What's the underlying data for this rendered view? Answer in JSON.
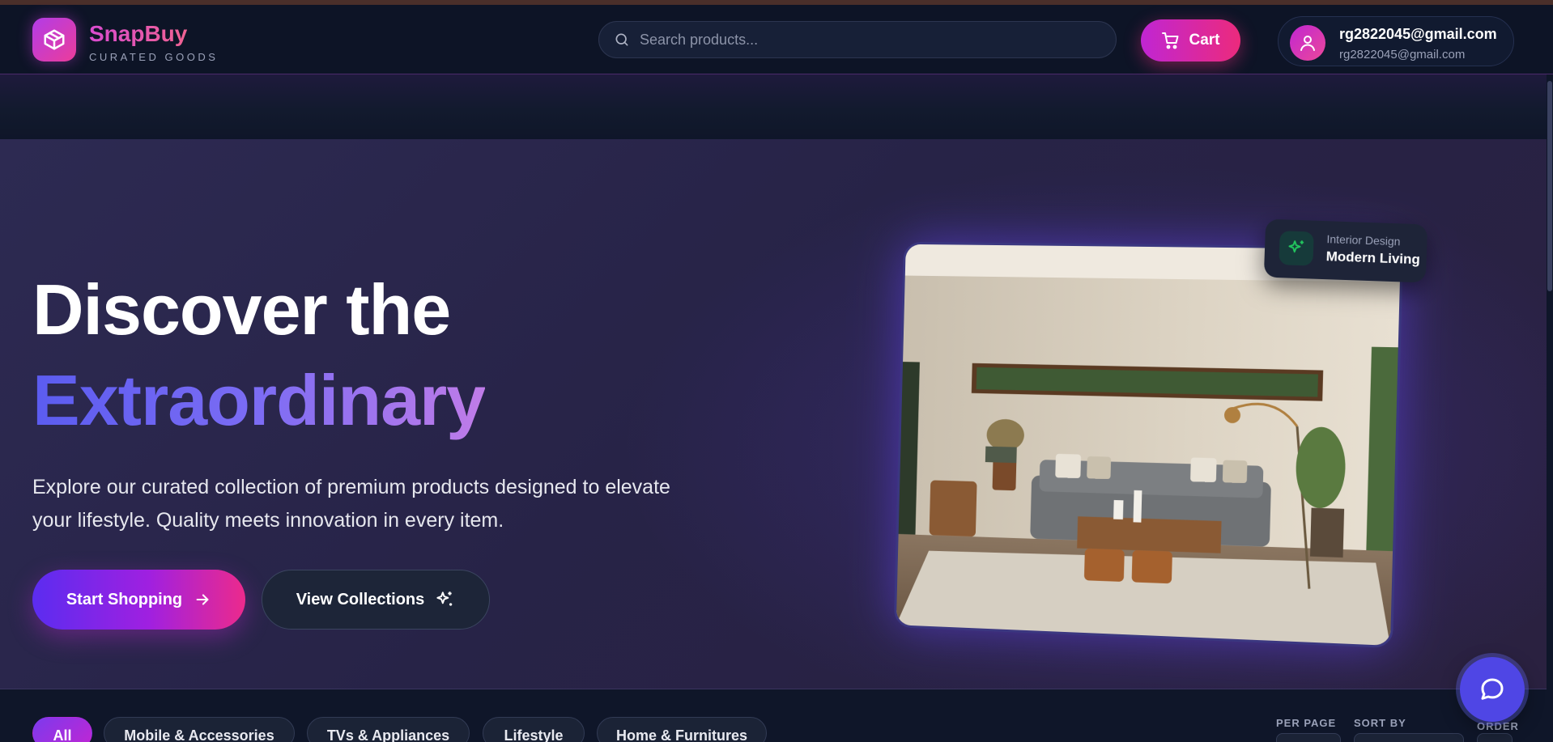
{
  "header": {
    "brand_name": "SnapBuy",
    "brand_tagline": "CURATED GOODS",
    "search_placeholder": "Search products...",
    "cart_label": "Cart",
    "user_name": "rg2822045@gmail.com",
    "user_email": "rg2822045@gmail.com"
  },
  "hero": {
    "title_line1": "Discover the",
    "title_line2": "Extraordinary",
    "description": "Explore our curated collection of premium products designed to elevate your lifestyle. Quality meets innovation in every item.",
    "primary_button": "Start Shopping",
    "secondary_button": "View Collections",
    "badge_label": "Interior Design",
    "badge_title": "Modern Living"
  },
  "categories": [
    "All",
    "Mobile & Accessories",
    "TVs & Appliances",
    "Lifestyle",
    "Home & Furnitures"
  ],
  "controls": {
    "per_page_label": "PER PAGE",
    "sort_by_label": "SORT BY",
    "order_label": "ORDER"
  },
  "colors": {
    "accent_pink": "#ec2a7c",
    "accent_purple": "#c026d3",
    "accent_indigo": "#5b5cf0",
    "background": "#0f1629",
    "hero_background": "#2d2a52"
  },
  "icons": {
    "logo": "package-icon",
    "search": "search-icon",
    "cart": "cart-icon",
    "user": "user-icon",
    "arrow": "arrow-right-icon",
    "sparkles": "sparkles-icon",
    "chat": "chat-bubble-icon"
  }
}
